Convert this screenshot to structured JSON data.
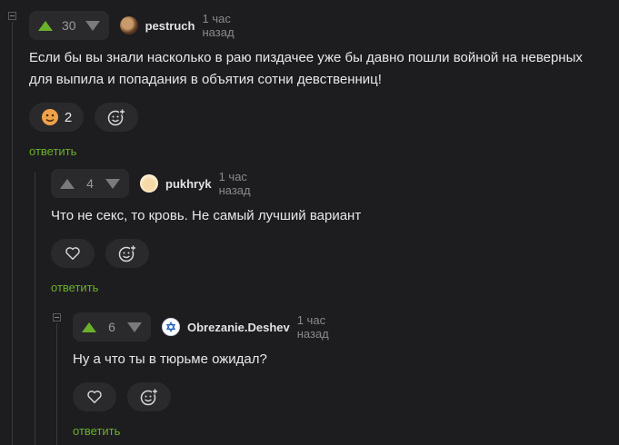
{
  "comments": [
    {
      "votes": "30",
      "author": "pestruch",
      "time": "1 час назад",
      "text": "Если бы вы знали насколько в раю пиздачее уже бы давно пошли войной на неверных для выпила и попадания в объятия сотни девственниц!",
      "reaction_count": "2",
      "reply_label": "ответить",
      "avatar_icon": "user-avatar"
    },
    {
      "votes": "4",
      "author": "pukhryk",
      "time": "1 час назад",
      "text": "Что не секс, то кровь. Не самый лучший вариант",
      "reply_label": "ответить",
      "avatar_icon": "user-avatar"
    },
    {
      "votes": "6",
      "author": "Obrezanie.Deshev",
      "time": "1 час назад",
      "text": "Ну а что ты в тюрьме ожидал?",
      "reply_label": "ответить",
      "avatar_icon": "star-of-david-avatar"
    }
  ],
  "icons": {
    "upvote": "arrow-up-icon",
    "downvote": "arrow-down-icon",
    "like": "heart-icon",
    "add_reaction": "smiley-plus-icon",
    "reaction": "face-emoji-icon"
  },
  "colors": {
    "background": "#1d1d1f",
    "accent_green": "#6bb02b",
    "button_bg": "#2a2a2d",
    "muted_text": "#8a8a8e"
  }
}
